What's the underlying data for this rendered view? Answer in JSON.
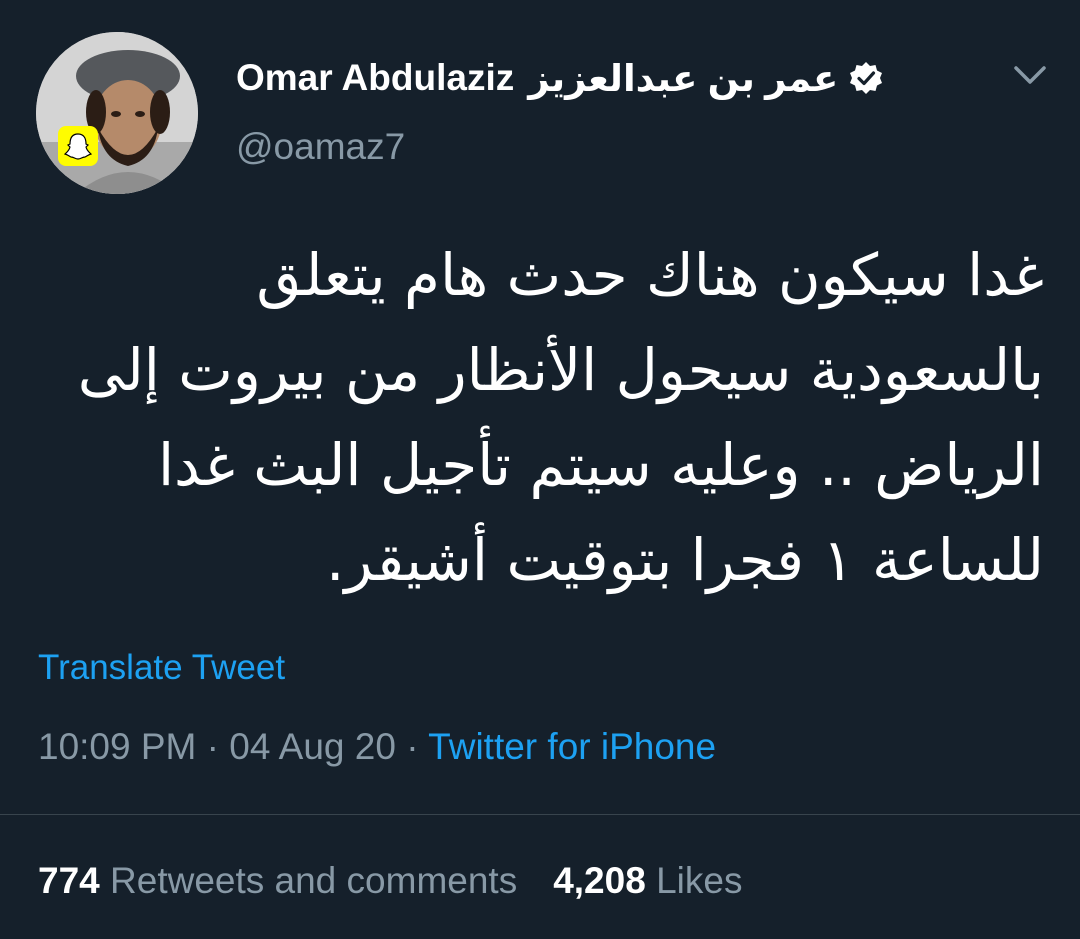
{
  "tweet": {
    "author": {
      "display_name": "Omar Abdulaziz",
      "arabic_name": "عمر بن عبدالعزيز",
      "handle": "@oamaz7",
      "verified": true,
      "avatar_icon": "snapchat-ghost-icon"
    },
    "menu_icon": "chevron-down-icon",
    "text_lines": [
      "غدا سيكون هناك حدث هام يتعلق",
      "بالسعودية سيحول الأنظار من بيروت إلى",
      "الرياض .. وعليه سيتم تأجيل البث غدا",
      "للساعة ١ فجرا بتوقيت أشيقر."
    ],
    "translate_label": "Translate Tweet",
    "time": "10:09 PM",
    "separator": "·",
    "date": "04 Aug 20",
    "source": "Twitter for iPhone",
    "stats": {
      "retweets_count": "774",
      "retweets_label": "Retweets and comments",
      "likes_count": "4,208",
      "likes_label": "Likes"
    }
  },
  "colors": {
    "background": "#15202b",
    "accent": "#1da1f2",
    "muted": "#8899a6",
    "divider": "#38444d"
  }
}
